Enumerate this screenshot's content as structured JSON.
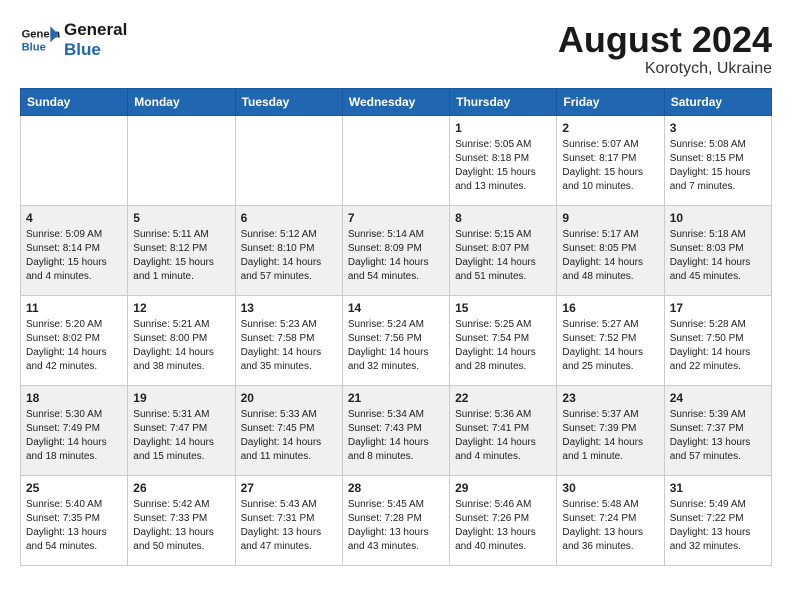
{
  "logo": {
    "line1": "General",
    "line2": "Blue"
  },
  "title": "August 2024",
  "subtitle": "Korotych, Ukraine",
  "days_header": [
    "Sunday",
    "Monday",
    "Tuesday",
    "Wednesday",
    "Thursday",
    "Friday",
    "Saturday"
  ],
  "weeks": [
    [
      {
        "num": "",
        "info": ""
      },
      {
        "num": "",
        "info": ""
      },
      {
        "num": "",
        "info": ""
      },
      {
        "num": "",
        "info": ""
      },
      {
        "num": "1",
        "info": "Sunrise: 5:05 AM\nSunset: 8:18 PM\nDaylight: 15 hours\nand 13 minutes."
      },
      {
        "num": "2",
        "info": "Sunrise: 5:07 AM\nSunset: 8:17 PM\nDaylight: 15 hours\nand 10 minutes."
      },
      {
        "num": "3",
        "info": "Sunrise: 5:08 AM\nSunset: 8:15 PM\nDaylight: 15 hours\nand 7 minutes."
      }
    ],
    [
      {
        "num": "4",
        "info": "Sunrise: 5:09 AM\nSunset: 8:14 PM\nDaylight: 15 hours\nand 4 minutes."
      },
      {
        "num": "5",
        "info": "Sunrise: 5:11 AM\nSunset: 8:12 PM\nDaylight: 15 hours\nand 1 minute."
      },
      {
        "num": "6",
        "info": "Sunrise: 5:12 AM\nSunset: 8:10 PM\nDaylight: 14 hours\nand 57 minutes."
      },
      {
        "num": "7",
        "info": "Sunrise: 5:14 AM\nSunset: 8:09 PM\nDaylight: 14 hours\nand 54 minutes."
      },
      {
        "num": "8",
        "info": "Sunrise: 5:15 AM\nSunset: 8:07 PM\nDaylight: 14 hours\nand 51 minutes."
      },
      {
        "num": "9",
        "info": "Sunrise: 5:17 AM\nSunset: 8:05 PM\nDaylight: 14 hours\nand 48 minutes."
      },
      {
        "num": "10",
        "info": "Sunrise: 5:18 AM\nSunset: 8:03 PM\nDaylight: 14 hours\nand 45 minutes."
      }
    ],
    [
      {
        "num": "11",
        "info": "Sunrise: 5:20 AM\nSunset: 8:02 PM\nDaylight: 14 hours\nand 42 minutes."
      },
      {
        "num": "12",
        "info": "Sunrise: 5:21 AM\nSunset: 8:00 PM\nDaylight: 14 hours\nand 38 minutes."
      },
      {
        "num": "13",
        "info": "Sunrise: 5:23 AM\nSunset: 7:58 PM\nDaylight: 14 hours\nand 35 minutes."
      },
      {
        "num": "14",
        "info": "Sunrise: 5:24 AM\nSunset: 7:56 PM\nDaylight: 14 hours\nand 32 minutes."
      },
      {
        "num": "15",
        "info": "Sunrise: 5:25 AM\nSunset: 7:54 PM\nDaylight: 14 hours\nand 28 minutes."
      },
      {
        "num": "16",
        "info": "Sunrise: 5:27 AM\nSunset: 7:52 PM\nDaylight: 14 hours\nand 25 minutes."
      },
      {
        "num": "17",
        "info": "Sunrise: 5:28 AM\nSunset: 7:50 PM\nDaylight: 14 hours\nand 22 minutes."
      }
    ],
    [
      {
        "num": "18",
        "info": "Sunrise: 5:30 AM\nSunset: 7:49 PM\nDaylight: 14 hours\nand 18 minutes."
      },
      {
        "num": "19",
        "info": "Sunrise: 5:31 AM\nSunset: 7:47 PM\nDaylight: 14 hours\nand 15 minutes."
      },
      {
        "num": "20",
        "info": "Sunrise: 5:33 AM\nSunset: 7:45 PM\nDaylight: 14 hours\nand 11 minutes."
      },
      {
        "num": "21",
        "info": "Sunrise: 5:34 AM\nSunset: 7:43 PM\nDaylight: 14 hours\nand 8 minutes."
      },
      {
        "num": "22",
        "info": "Sunrise: 5:36 AM\nSunset: 7:41 PM\nDaylight: 14 hours\nand 4 minutes."
      },
      {
        "num": "23",
        "info": "Sunrise: 5:37 AM\nSunset: 7:39 PM\nDaylight: 14 hours\nand 1 minute."
      },
      {
        "num": "24",
        "info": "Sunrise: 5:39 AM\nSunset: 7:37 PM\nDaylight: 13 hours\nand 57 minutes."
      }
    ],
    [
      {
        "num": "25",
        "info": "Sunrise: 5:40 AM\nSunset: 7:35 PM\nDaylight: 13 hours\nand 54 minutes."
      },
      {
        "num": "26",
        "info": "Sunrise: 5:42 AM\nSunset: 7:33 PM\nDaylight: 13 hours\nand 50 minutes."
      },
      {
        "num": "27",
        "info": "Sunrise: 5:43 AM\nSunset: 7:31 PM\nDaylight: 13 hours\nand 47 minutes."
      },
      {
        "num": "28",
        "info": "Sunrise: 5:45 AM\nSunset: 7:28 PM\nDaylight: 13 hours\nand 43 minutes."
      },
      {
        "num": "29",
        "info": "Sunrise: 5:46 AM\nSunset: 7:26 PM\nDaylight: 13 hours\nand 40 minutes."
      },
      {
        "num": "30",
        "info": "Sunrise: 5:48 AM\nSunset: 7:24 PM\nDaylight: 13 hours\nand 36 minutes."
      },
      {
        "num": "31",
        "info": "Sunrise: 5:49 AM\nSunset: 7:22 PM\nDaylight: 13 hours\nand 32 minutes."
      }
    ]
  ]
}
